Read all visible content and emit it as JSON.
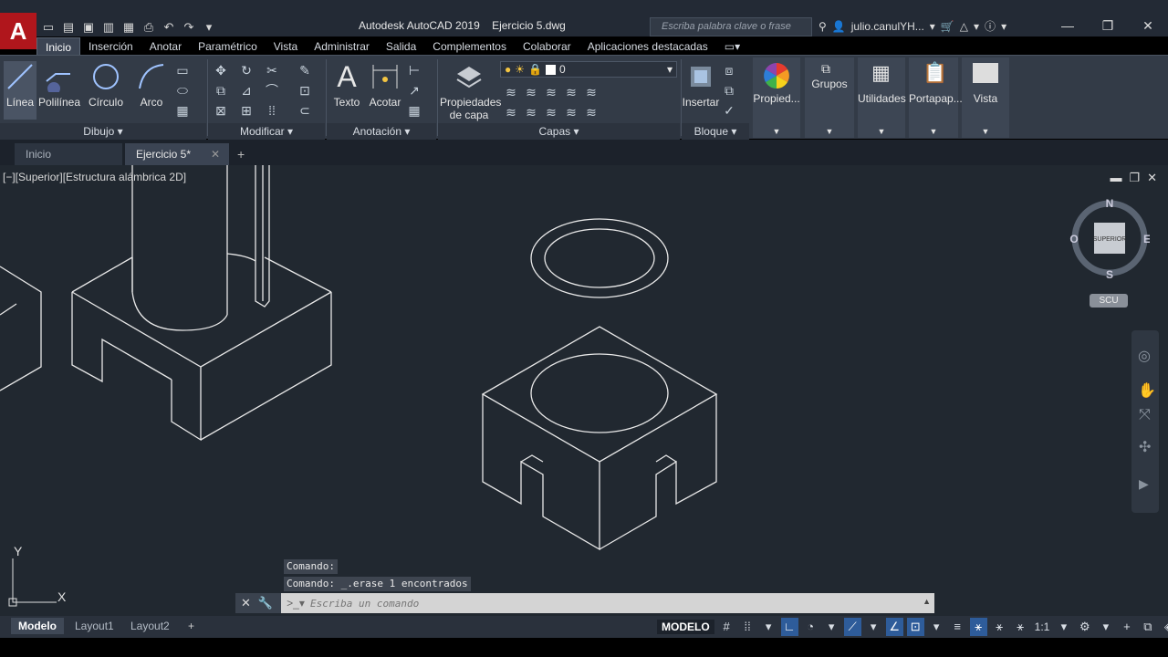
{
  "titlebar": {
    "app_title": "Autodesk AutoCAD 2019    Ejercicio 5.dwg",
    "search_placeholder": "Escriba palabra clave o frase",
    "user_name": "julio.canulYH...",
    "app_logo_letter": "A"
  },
  "ribbon_tabs": [
    "Inicio",
    "Inserción",
    "Anotar",
    "Paramétrico",
    "Vista",
    "Administrar",
    "Salida",
    "Complementos",
    "Colaborar",
    "Aplicaciones destacadas"
  ],
  "ribbon": {
    "dibujo": {
      "title": "Dibujo",
      "linea": "Línea",
      "polilinea": "Polilínea",
      "circulo": "Círculo",
      "arco": "Arco"
    },
    "modificar": {
      "title": "Modificar"
    },
    "anotacion": {
      "title": "Anotación",
      "texto": "Texto",
      "acotar": "Acotar"
    },
    "capas": {
      "title": "Capas",
      "propiedades": "Propiedades de capa",
      "propiedades_line1": "Propiedades",
      "propiedades_line2": "de capa",
      "layer_value": "0"
    },
    "bloque": {
      "title": "Bloque",
      "insertar": "Insertar"
    },
    "propiedades": "Propied...",
    "grupos": "Grupos",
    "utilidades": "Utilidades",
    "portapapeles": "Portapap...",
    "vista": "Vista"
  },
  "file_tabs": {
    "inicio": "Inicio",
    "active": "Ejercicio 5*"
  },
  "viewport": {
    "label": "[−][Superior][Estructura alámbrica 2D]",
    "viewcube_face": "SUPERIOR",
    "compass": {
      "n": "N",
      "s": "S",
      "e": "E",
      "w": "O"
    },
    "ucs_button": "SCU",
    "axis_x": "X",
    "axis_y": "Y"
  },
  "command": {
    "history_1": "Comando:",
    "history_2": "Comando:  _.erase 1 encontrados",
    "placeholder": "Escriba un comando"
  },
  "statusbar": {
    "layouts": [
      "Modelo",
      "Layout1",
      "Layout2"
    ],
    "modelo_button": "MODELO",
    "scale": "1:1"
  },
  "colors": {
    "canvas_bg": "#212830",
    "ribbon_bg": "#333b47",
    "accent_blue": "#2e5c9a",
    "logo_red": "#b0161c"
  }
}
